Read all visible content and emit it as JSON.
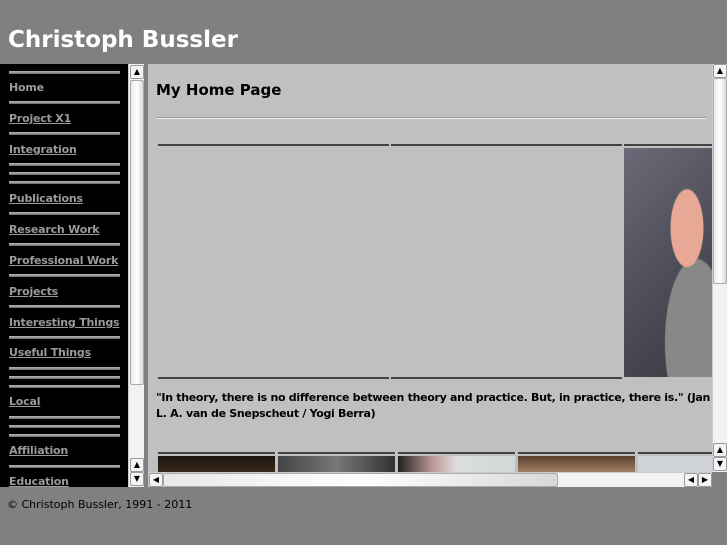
{
  "header": {
    "title": "Christoph Bussler"
  },
  "nav": {
    "items": [
      {
        "label": "Home"
      },
      {
        "label": "Project X1"
      },
      {
        "label": "Integration"
      },
      {
        "label": "Publications"
      },
      {
        "label": "Research Work"
      },
      {
        "label": "Professional Work"
      },
      {
        "label": "Projects"
      },
      {
        "label": "Interesting Things"
      },
      {
        "label": "Useful Things"
      },
      {
        "label": "Local"
      },
      {
        "label": "Affiliation"
      },
      {
        "label": "Education"
      }
    ]
  },
  "main": {
    "title": "My Home Page",
    "quote": "\"In theory, there is no difference between theory and practice. But, in practice, there is.\" (Jan L. A. van de Snepscheut / Yogi Berra)"
  },
  "footer": {
    "text": "© Christoph Bussler, 1991 - 2011"
  }
}
